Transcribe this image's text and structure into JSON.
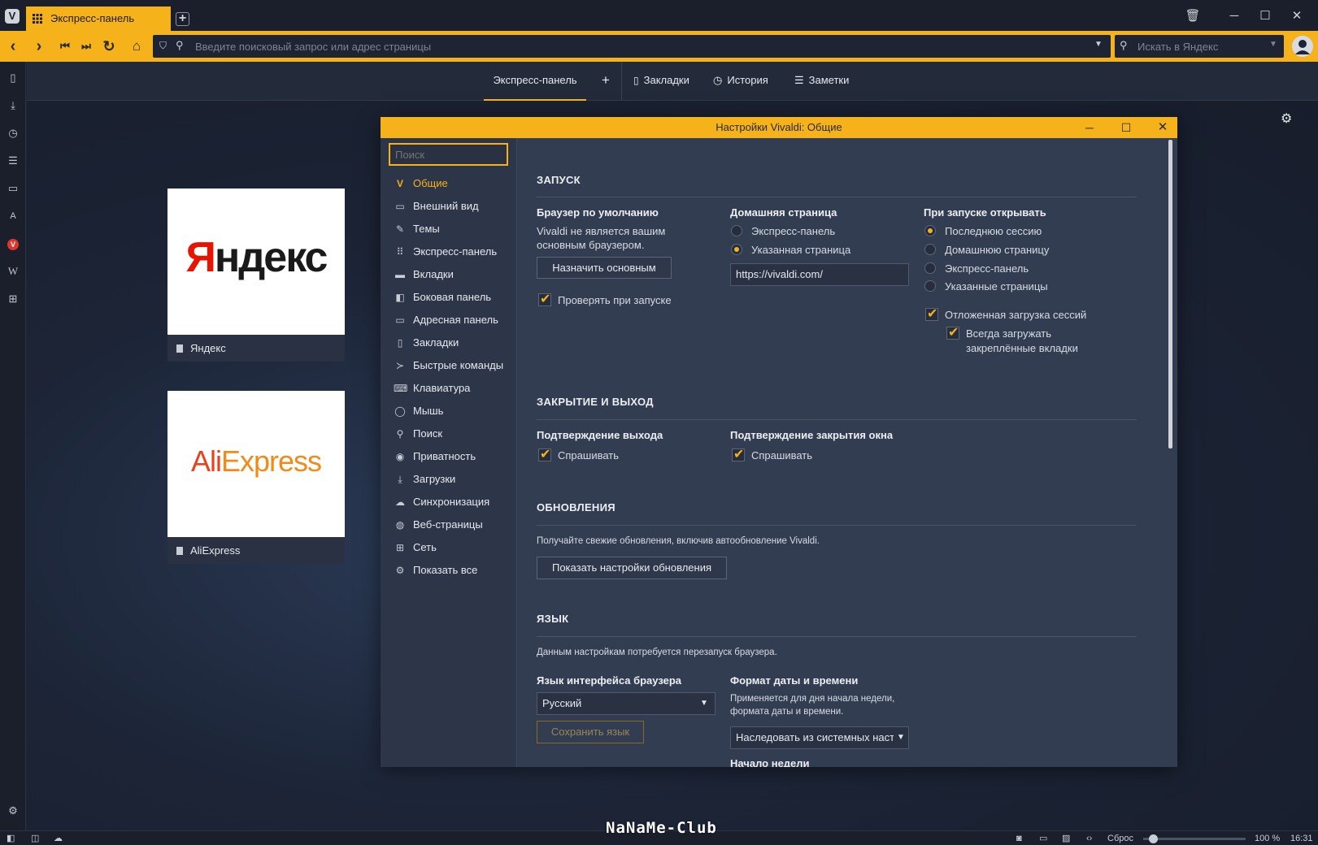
{
  "browser": {
    "tab_title": "Экспресс-панель",
    "address_placeholder": "Введите поисковый запрос или адрес страницы",
    "search_placeholder": "Искать в Яндекс"
  },
  "start_page": {
    "tabs": [
      "Экспресс-панель",
      "+",
      "Закладки",
      "История",
      "Заметки"
    ],
    "dials": [
      {
        "title": "Яндекс",
        "logo": "Яндекс"
      },
      {
        "title": "AliExpress",
        "logo": "AliExpress"
      }
    ]
  },
  "settings": {
    "window_title": "Настройки Vivaldi: Общие",
    "search_placeholder": "Поиск",
    "nav": [
      {
        "label": "Общие",
        "icon": "vivaldi-icon",
        "glyph": "V"
      },
      {
        "label": "Внешний вид",
        "icon": "folder-icon",
        "glyph": "▭"
      },
      {
        "label": "Темы",
        "icon": "brush-icon",
        "glyph": "✎"
      },
      {
        "label": "Экспресс-панель",
        "icon": "grid-icon",
        "glyph": "⠿"
      },
      {
        "label": "Вкладки",
        "icon": "tabs-icon",
        "glyph": "▬"
      },
      {
        "label": "Боковая панель",
        "icon": "sidebar-icon",
        "glyph": "◧"
      },
      {
        "label": "Адресная панель",
        "icon": "address-bar-icon",
        "glyph": "▭"
      },
      {
        "label": "Закладки",
        "icon": "bookmark-icon",
        "glyph": "▯"
      },
      {
        "label": "Быстрые команды",
        "icon": "quick-commands-icon",
        "glyph": "≻"
      },
      {
        "label": "Клавиатура",
        "icon": "keyboard-icon",
        "glyph": "⌨"
      },
      {
        "label": "Мышь",
        "icon": "mouse-icon",
        "glyph": "◯"
      },
      {
        "label": "Поиск",
        "icon": "search-icon",
        "glyph": "⚲"
      },
      {
        "label": "Приватность",
        "icon": "eye-icon",
        "glyph": "◉"
      },
      {
        "label": "Загрузки",
        "icon": "download-icon",
        "glyph": "⤓"
      },
      {
        "label": "Синхронизация",
        "icon": "cloud-icon",
        "glyph": "☁"
      },
      {
        "label": "Веб-страницы",
        "icon": "globe-icon",
        "glyph": "◍"
      },
      {
        "label": "Сеть",
        "icon": "network-icon",
        "glyph": "⊞"
      },
      {
        "label": "Показать все",
        "icon": "gear-icon",
        "glyph": "⚙"
      }
    ],
    "startup": {
      "section": "ЗАПУСК",
      "default_browser_label": "Браузер по умолчанию",
      "default_browser_text_1": "Vivaldi не является вашим",
      "default_browser_text_2": "основным браузером.",
      "set_default_button": "Назначить основным",
      "check_on_startup": "Проверять при запуске",
      "homepage_label": "Домашняя страница",
      "homepage_options": [
        "Экспресс-панель",
        "Указанная страница"
      ],
      "homepage_selected": 1,
      "homepage_url": "https://vivaldi.com/",
      "open_label": "При запуске открывать",
      "open_options": [
        "Последнюю сессию",
        "Домашнюю страницу",
        "Экспресс-панель",
        "Указанные страницы"
      ],
      "open_selected": 0,
      "lazy_load": "Отложенная загрузка сессий",
      "always_load_1": "Всегда загружать",
      "always_load_2": "закреплённые вкладки"
    },
    "closing": {
      "section": "ЗАКРЫТИЕ И ВЫХОД",
      "confirm_exit_label": "Подтверждение выхода",
      "confirm_exit_check": "Спрашивать",
      "confirm_close_label": "Подтверждение закрытия окна",
      "confirm_close_check": "Спрашивать"
    },
    "updates": {
      "section": "ОБНОВЛЕНИЯ",
      "text": "Получайте свежие обновления, включив автообновление Vivaldi.",
      "button": "Показать настройки обновления"
    },
    "language": {
      "section": "ЯЗЫК",
      "text": "Данным настройкам потребуется перезапуск браузера.",
      "ui_language_label": "Язык интерфейса браузера",
      "ui_language_value": "Русский",
      "save_button": "Сохранить язык",
      "date_format_label": "Формат даты и времени",
      "date_format_text_1": "Применяется для дня начала недели,",
      "date_format_text_2": "формата даты и времени.",
      "date_format_value": "Наследовать из системных наст",
      "week_start_label": "Начало недели"
    }
  },
  "statusbar": {
    "reset": "Сброс",
    "zoom": "100 %",
    "time": "16:31",
    "zoom_level": 1.0
  },
  "watermark": "NaNaMe-Club",
  "colors": {
    "accent": "#f5b21b",
    "bg": "#1e2433",
    "panel": "#333d52"
  }
}
